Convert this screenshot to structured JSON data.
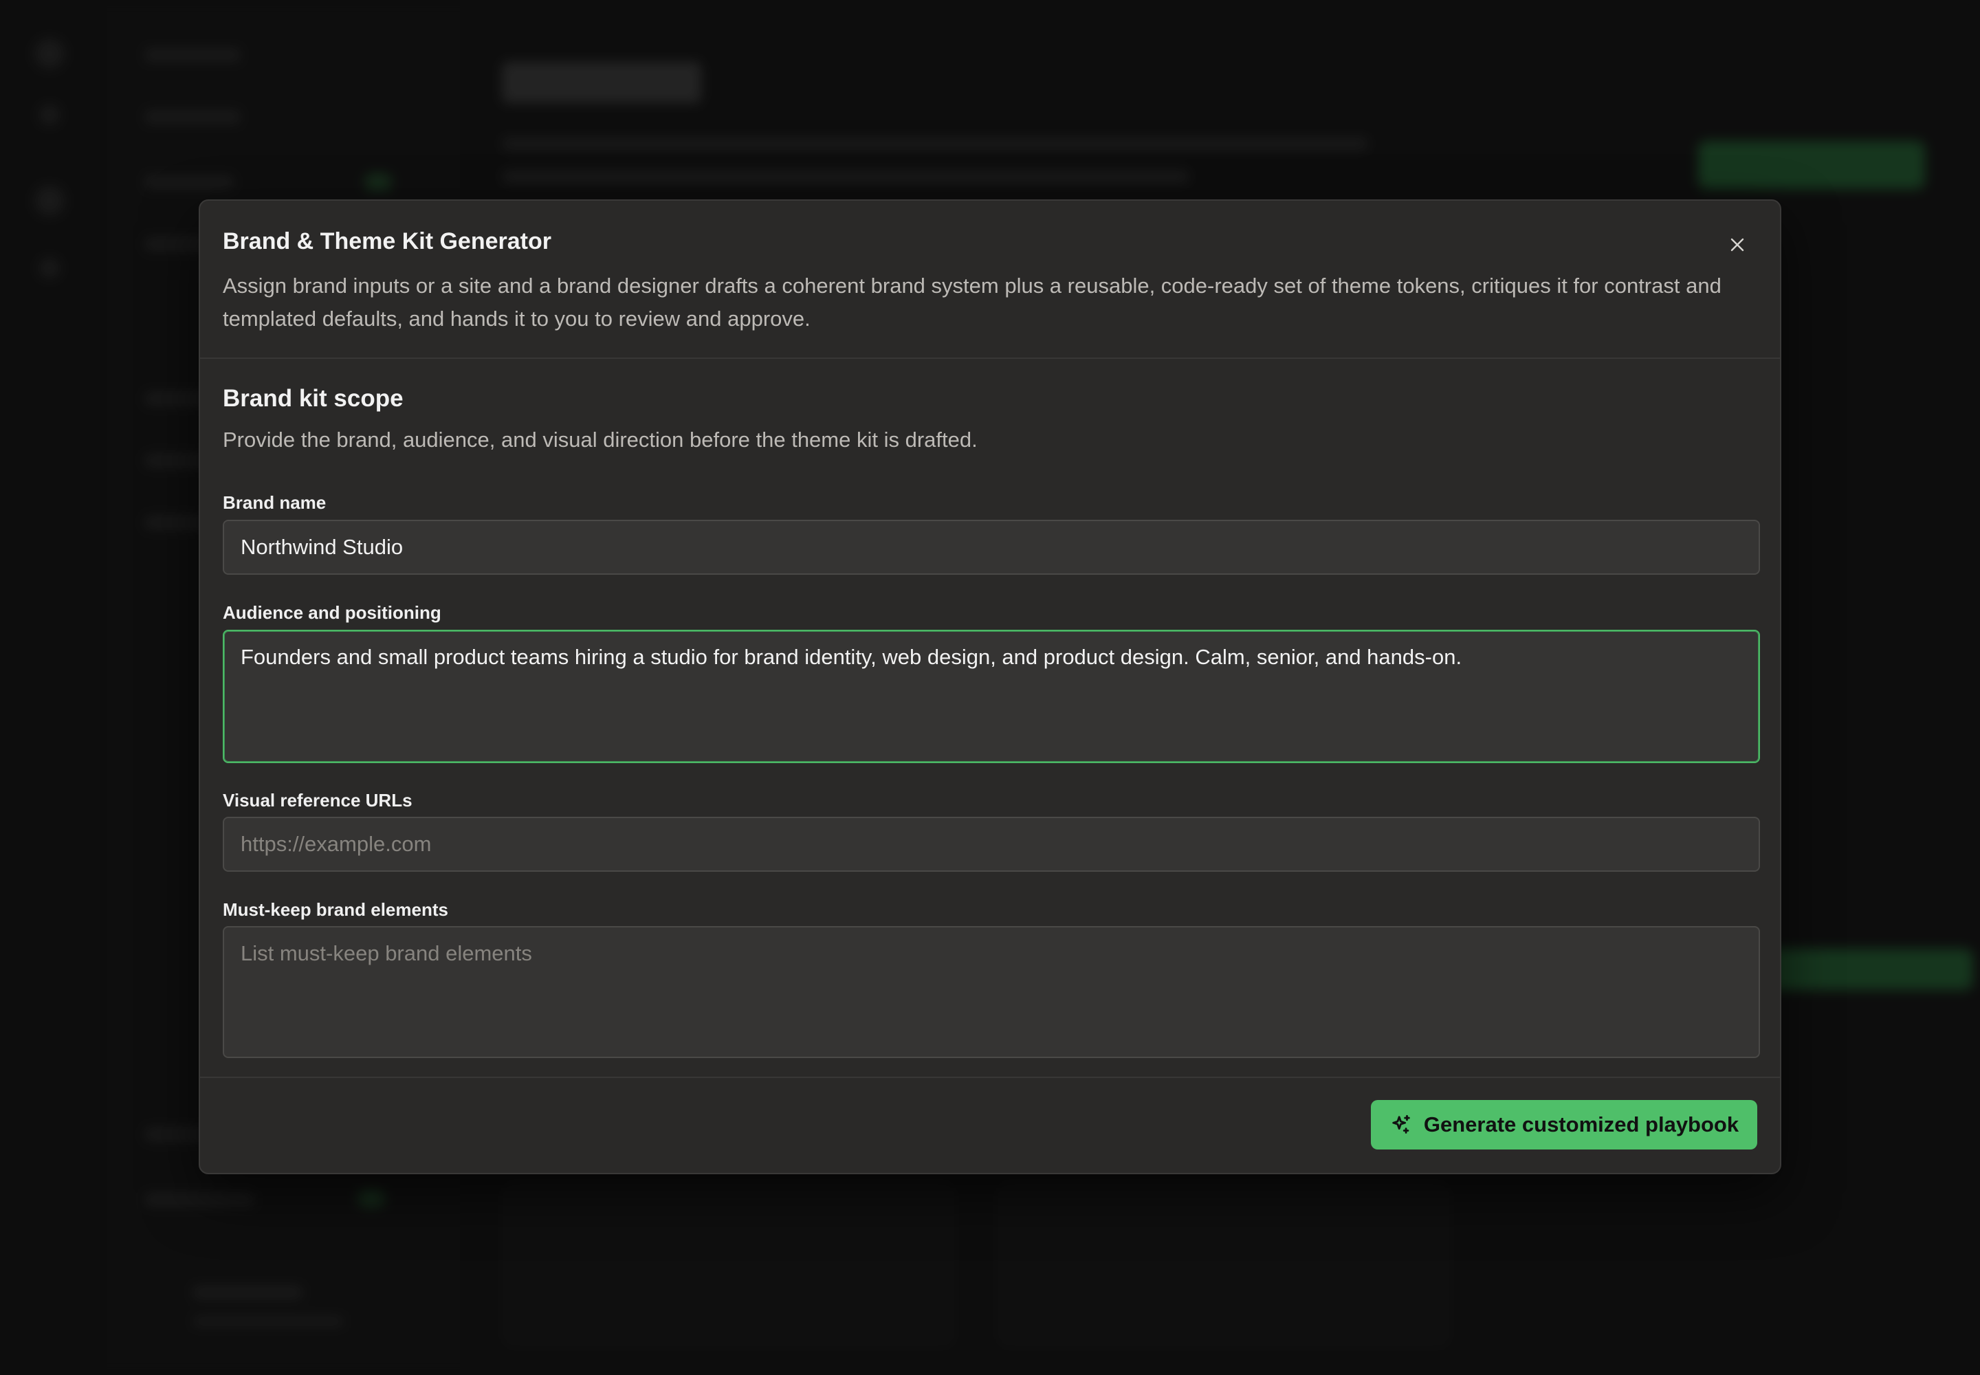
{
  "dialog": {
    "title": "Brand & Theme Kit Generator",
    "description": "Assign brand inputs or a site and a brand designer drafts a coherent brand system plus a reusable, code-ready set of theme tokens, critiques it for contrast and templated defaults, and hands it to you to review and approve.",
    "close_icon": "close-icon"
  },
  "section": {
    "title": "Brand kit scope",
    "description": "Provide the brand, audience, and visual direction before the theme kit is drafted."
  },
  "fields": {
    "brand_name": {
      "label": "Brand name",
      "value": "Northwind Studio"
    },
    "audience": {
      "label": "Audience and positioning",
      "value": "Founders and small product teams hiring a studio for brand identity, web design, and product design. Calm, senior, and hands-on."
    },
    "visual_refs": {
      "label": "Visual reference URLs",
      "placeholder": "https://example.com"
    },
    "must_keep": {
      "label": "Must-keep brand elements",
      "placeholder": "List must-keep brand elements"
    }
  },
  "footer": {
    "generate_label": "Generate customized playbook",
    "generate_icon": "sparkles-icon"
  },
  "colors": {
    "accent": "#4fbf69",
    "dialog_bg": "#2a2928",
    "page_bg": "#141414"
  }
}
